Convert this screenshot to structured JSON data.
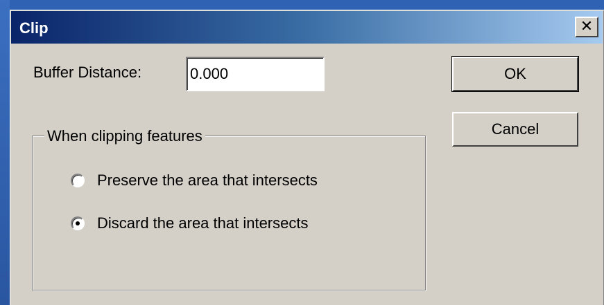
{
  "window": {
    "title": "Clip",
    "close_glyph": "✕"
  },
  "buffer": {
    "label": "Buffer Distance:",
    "value": "0.000"
  },
  "buttons": {
    "ok_label": "OK",
    "cancel_label": "Cancel"
  },
  "group": {
    "title": "When clipping features",
    "options": [
      {
        "label": "Preserve the area that intersects",
        "selected": false
      },
      {
        "label": "Discard the area that intersects",
        "selected": true
      }
    ]
  },
  "colors": {
    "title_gradient_start": "#0a246a",
    "title_gradient_end": "#a6caf0",
    "dialog_face": "#d4d0c8"
  }
}
